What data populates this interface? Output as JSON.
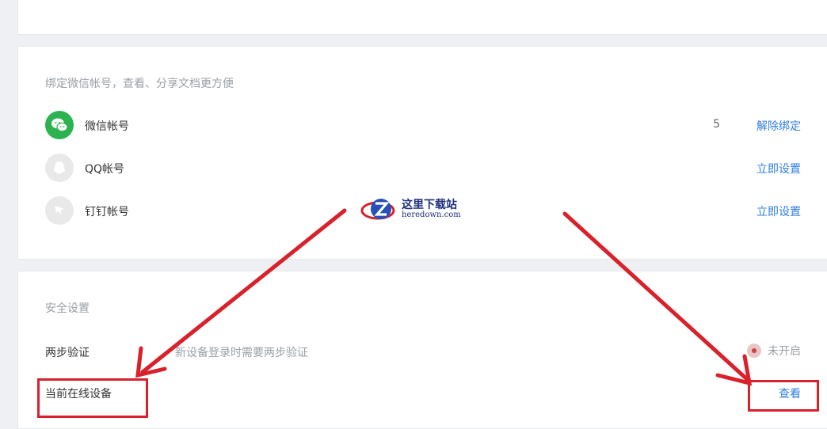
{
  "bind_section": {
    "hint": "绑定微信帐号，查看、分享文档更方便",
    "accounts": [
      {
        "label": "微信帐号",
        "count": "5",
        "action": "解除绑定",
        "icon": "wechat-icon",
        "color": "#2cb24f"
      },
      {
        "label": "QQ帐号",
        "count": "",
        "action": "立即设置",
        "icon": "qq-icon",
        "color": "#d9d9d9"
      },
      {
        "label": "钉钉帐号",
        "count": "",
        "action": "立即设置",
        "icon": "dingtalk-icon",
        "color": "#d9d9d9"
      }
    ]
  },
  "security_section": {
    "title": "安全设置",
    "two_step": {
      "label": "两步验证",
      "description": "新设备登录时需要两步验证",
      "status": "未开启"
    },
    "online_devices": {
      "label": "当前在线设备",
      "action": "查看"
    }
  },
  "watermark": {
    "name": "这里下载站",
    "url": "heredown.com"
  },
  "colors": {
    "link": "#2f7de1",
    "annotation": "#d8212b",
    "wechat": "#2cb24f"
  }
}
